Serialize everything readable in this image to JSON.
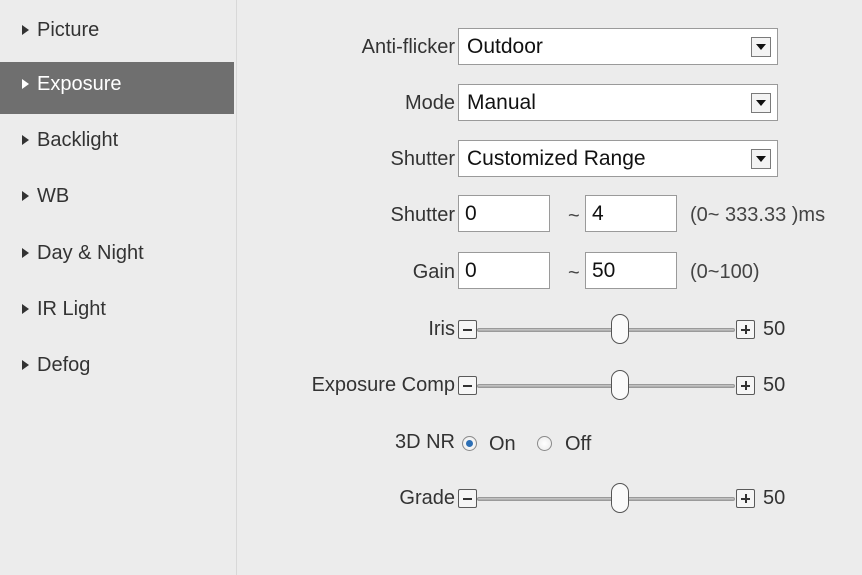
{
  "sidebar": {
    "items": [
      {
        "label": "Picture",
        "active": false
      },
      {
        "label": "Exposure",
        "active": true
      },
      {
        "label": "Backlight",
        "active": false
      },
      {
        "label": "WB",
        "active": false
      },
      {
        "label": "Day & Night",
        "active": false
      },
      {
        "label": "IR Light",
        "active": false
      },
      {
        "label": "Defog",
        "active": false
      }
    ]
  },
  "form": {
    "anti_flicker": {
      "label": "Anti-flicker",
      "value": "Outdoor"
    },
    "mode": {
      "label": "Mode",
      "value": "Manual"
    },
    "shutter_select": {
      "label": "Shutter",
      "value": "Customized Range"
    },
    "shutter_range": {
      "label": "Shutter",
      "min": "0",
      "max": "4",
      "separator": "~",
      "hint": "(0~ 333.33 )ms"
    },
    "gain_range": {
      "label": "Gain",
      "min": "0",
      "max": "50",
      "separator": "~",
      "hint": "(0~100)"
    },
    "iris": {
      "label": "Iris",
      "value": "50",
      "level": 0.5
    },
    "exposure_comp": {
      "label": "Exposure Comp",
      "value": "50",
      "level": 0.5
    },
    "nr_3d": {
      "label": "3D NR",
      "options": [
        "On",
        "Off"
      ],
      "selected": "On"
    },
    "grade": {
      "label": "Grade",
      "value": "50",
      "level": 0.5
    }
  },
  "colors": {
    "active_nav_bg": "#6f6f6f",
    "page_bg": "#ececec",
    "radio_accent": "#2d6fb5"
  }
}
